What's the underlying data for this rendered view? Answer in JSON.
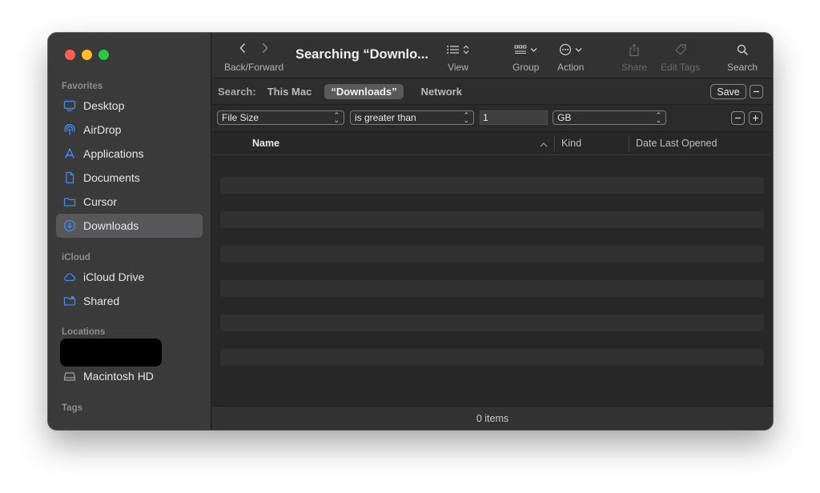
{
  "window": {
    "title": "Searching “Downlo..."
  },
  "toolbar": {
    "back_forward_label": "Back/Forward",
    "view_label": "View",
    "group_label": "Group",
    "action_label": "Action",
    "share_label": "Share",
    "edit_tags_label": "Edit Tags",
    "search_label": "Search"
  },
  "sidebar": {
    "favorites_label": "Favorites",
    "favorites": [
      {
        "label": "Desktop",
        "icon": "desktop-icon"
      },
      {
        "label": "AirDrop",
        "icon": "airdrop-icon"
      },
      {
        "label": "Applications",
        "icon": "applications-icon"
      },
      {
        "label": "Documents",
        "icon": "document-icon"
      },
      {
        "label": "Cursor",
        "icon": "folder-icon"
      },
      {
        "label": "Downloads",
        "icon": "downloads-icon",
        "selected": true
      }
    ],
    "icloud_label": "iCloud",
    "icloud": [
      {
        "label": "iCloud Drive",
        "icon": "cloud-icon"
      },
      {
        "label": "Shared",
        "icon": "shared-folder-icon"
      }
    ],
    "locations_label": "Locations",
    "locations": [
      {
        "label": "Macintosh HD",
        "icon": "disk-icon"
      }
    ],
    "tags_label": "Tags"
  },
  "search_scope": {
    "label": "Search:",
    "options": [
      "This Mac",
      "“Downloads”",
      "Network"
    ],
    "selected": "“Downloads”",
    "save_label": "Save"
  },
  "criteria": {
    "attribute": "File Size",
    "operator": "is greater than",
    "value": "1",
    "unit": "GB"
  },
  "columns": {
    "name": "Name",
    "kind": "Kind",
    "date_last_opened": "Date Last Opened"
  },
  "status": {
    "items": "0 items"
  },
  "colors": {
    "accent": "#3b82f6",
    "close": "#fe5f57",
    "minimize": "#febc2e",
    "maximize": "#28c840"
  }
}
